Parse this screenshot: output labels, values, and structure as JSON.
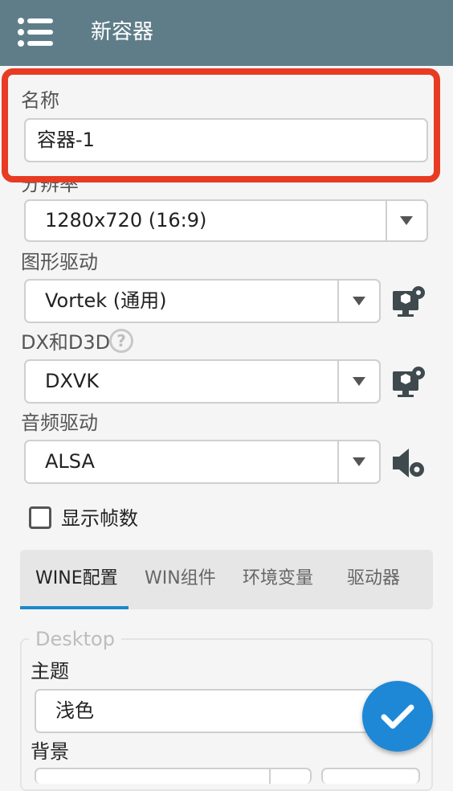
{
  "appbar": {
    "title": "新容器"
  },
  "name_field": {
    "label": "名称",
    "value": "容器-1"
  },
  "resolution": {
    "label": "分辨率",
    "value": "1280x720 (16:9)"
  },
  "graphics": {
    "label": "图形驱动",
    "value": "Vortek (通用)"
  },
  "dx": {
    "label": "DX和D3D",
    "value": "DXVK"
  },
  "audio": {
    "label": "音频驱动",
    "value": "ALSA"
  },
  "show_fps": {
    "label": "显示帧数",
    "checked": false
  },
  "tabs": [
    {
      "label": "WINE配置",
      "active": true
    },
    {
      "label": "WIN组件"
    },
    {
      "label": "环境变量"
    },
    {
      "label": "驱动器"
    }
  ],
  "desktop": {
    "title": "Desktop",
    "theme_label": "主题",
    "theme_value": "浅色",
    "background_label": "背景"
  },
  "colors": {
    "appbar": "#5f7d89",
    "highlight": "#e83b24",
    "accent": "#1e88d6"
  },
  "icons": [
    "menu-icon",
    "chevron-down-icon",
    "monitor-gear-icon",
    "help-icon",
    "speaker-gear-icon",
    "check-icon"
  ]
}
